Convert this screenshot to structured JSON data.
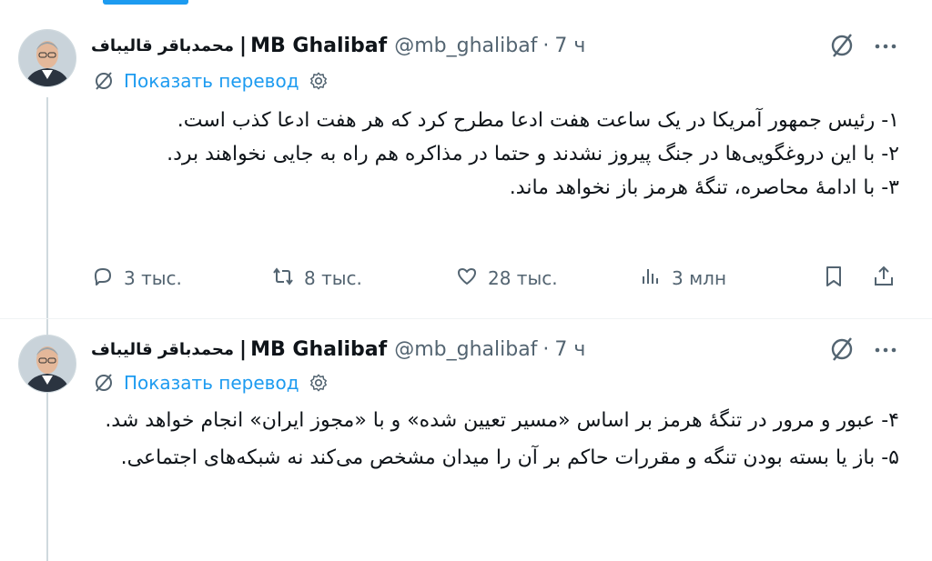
{
  "tweets": [
    {
      "author_fa": "محمدباقر قالیباف",
      "separator": "|",
      "author_en": "MB Ghalibaf",
      "handle": "@mb_ghalibaf",
      "dot": "·",
      "time": "7 ч",
      "translate_label": "Показать перевод",
      "lines": [
        "۱- رئیس جمهور آمریکا در یک ساعت هفت ادعا مطرح کرد که هر هفت ادعا کذب است.",
        "۲- با این دروغگویی‌ها در جنگ پیروز نشدند و حتما در مذاکره هم راه به جایی نخواهند برد.",
        "۳- با ادامهٔ محاصره، تنگهٔ هرمز باز نخواهد ماند."
      ],
      "actions": {
        "replies": "3 тыс.",
        "reposts": "8 тыс.",
        "likes": "28 тыс.",
        "views": "3 млн"
      }
    },
    {
      "author_fa": "محمدباقر قالیباف",
      "separator": "|",
      "author_en": "MB Ghalibaf",
      "handle": "@mb_ghalibaf",
      "dot": "·",
      "time": "7 ч",
      "translate_label": "Показать перевод",
      "lines": [
        "۴- عبور و مرور در تنگهٔ هرمز بر اساس «مسیر تعیین شده» و با «مجوز ایران» انجام خواهد شد.",
        "۵- باز یا بسته بودن تنگه و مقررات حاکم بر آن را میدان مشخص می‌کند نه شبکه‌های اجتماعی."
      ]
    }
  ],
  "icons": {
    "grok": "grok-icon",
    "more": "more-icon",
    "translate": "translate-icon",
    "settings": "gear-icon",
    "reply": "reply-icon",
    "repost": "repost-icon",
    "like": "heart-icon",
    "views": "views-icon",
    "bookmark": "bookmark-icon",
    "share": "share-icon"
  },
  "colors": {
    "accent": "#1d9bf0",
    "text": "#0f1419",
    "muted": "#536471"
  }
}
